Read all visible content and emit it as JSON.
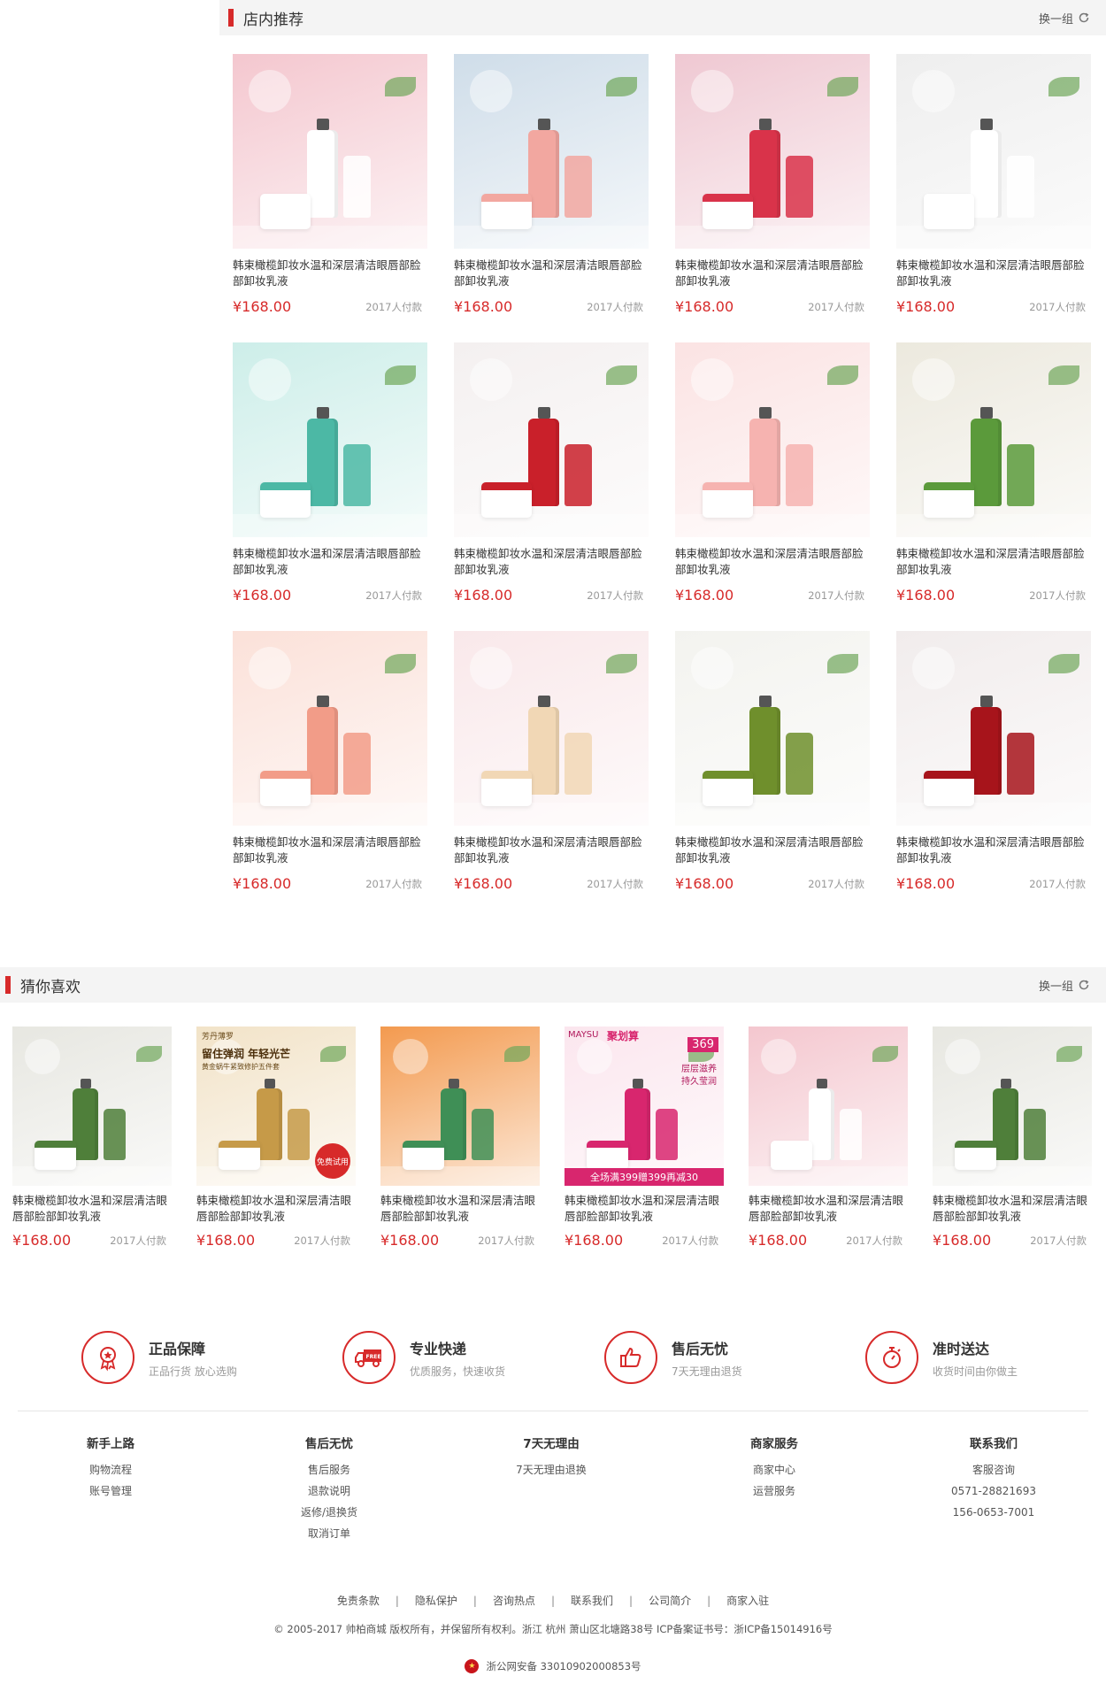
{
  "recommend": {
    "title": "店内推荐",
    "refresh_label": "换一组",
    "products": [
      {
        "name": "韩束橄榄卸妆水温和深层清洁眼唇部脸部卸妆乳液",
        "price": "¥168.00",
        "sold": "2017人付款",
        "bg": "#f4c7cf",
        "accent": "#ffffff"
      },
      {
        "name": "韩束橄榄卸妆水温和深层清洁眼唇部脸部卸妆乳液",
        "price": "¥168.00",
        "sold": "2017人付款",
        "bg": "#cfdde9",
        "accent": "#f2a7a0"
      },
      {
        "name": "韩束橄榄卸妆水温和深层清洁眼唇部脸部卸妆乳液",
        "price": "¥168.00",
        "sold": "2017人付款",
        "bg": "#efc8d2",
        "accent": "#d9334a"
      },
      {
        "name": "韩束橄榄卸妆水温和深层清洁眼唇部脸部卸妆乳液",
        "price": "¥168.00",
        "sold": "2017人付款",
        "bg": "#eeeeee",
        "accent": "#ffffff"
      },
      {
        "name": "韩束橄榄卸妆水温和深层清洁眼唇部脸部卸妆乳液",
        "price": "¥168.00",
        "sold": "2017人付款",
        "bg": "#cdeee9",
        "accent": "#4cb8a5"
      },
      {
        "name": "韩束橄榄卸妆水温和深层清洁眼唇部脸部卸妆乳液",
        "price": "¥168.00",
        "sold": "2017人付款",
        "bg": "#f4f0f0",
        "accent": "#c9202a"
      },
      {
        "name": "韩束橄榄卸妆水温和深层清洁眼唇部脸部卸妆乳液",
        "price": "¥168.00",
        "sold": "2017人付款",
        "bg": "#fbe3e3",
        "accent": "#f6b3b0"
      },
      {
        "name": "韩束橄榄卸妆水温和深层清洁眼唇部脸部卸妆乳液",
        "price": "¥168.00",
        "sold": "2017人付款",
        "bg": "#ece9de",
        "accent": "#5b9a3b"
      },
      {
        "name": "韩束橄榄卸妆水温和深层清洁眼唇部脸部卸妆乳液",
        "price": "¥168.00",
        "sold": "2017人付款",
        "bg": "#fbe1d9",
        "accent": "#f29c88"
      },
      {
        "name": "韩束橄榄卸妆水温和深层清洁眼唇部脸部卸妆乳液",
        "price": "¥168.00",
        "sold": "2017人付款",
        "bg": "#f9e8ea",
        "accent": "#f1d7b5"
      },
      {
        "name": "韩束橄榄卸妆水温和深层清洁眼唇部脸部卸妆乳液",
        "price": "¥168.00",
        "sold": "2017人付款",
        "bg": "#f3f3ef",
        "accent": "#6f8f2c"
      },
      {
        "name": "韩束橄榄卸妆水温和深层清洁眼唇部脸部卸妆乳液",
        "price": "¥168.00",
        "sold": "2017人付款",
        "bg": "#f1ecec",
        "accent": "#a7141b"
      }
    ]
  },
  "guess": {
    "title": "猜你喜欢",
    "refresh_label": "换一组",
    "products": [
      {
        "name": "韩束橄榄卸妆水温和深层清洁眼唇部脸部卸妆乳液",
        "price": "¥168.00",
        "sold": "2017人付款",
        "bg": "#e7e7e1",
        "accent": "#4f7f3a"
      },
      {
        "name": "韩束橄榄卸妆水温和深层清洁眼唇部脸部卸妆乳液",
        "price": "¥168.00",
        "sold": "2017人付款",
        "bg": "#f2e3c8",
        "accent": "#c69a48"
      },
      {
        "name": "韩束橄榄卸妆水温和深层清洁眼唇部脸部卸妆乳液",
        "price": "¥168.00",
        "sold": "2017人付款",
        "bg": "#f39a4f",
        "accent": "#3f8f56"
      },
      {
        "name": "韩束橄榄卸妆水温和深层清洁眼唇部脸部卸妆乳液",
        "price": "¥168.00",
        "sold": "2017人付款",
        "bg": "#fbe6ee",
        "accent": "#d8266e"
      },
      {
        "name": "韩束橄榄卸妆水温和深层清洁眼唇部脸部卸妆乳液",
        "price": "¥168.00",
        "sold": "2017人付款",
        "bg": "#f4c7cf",
        "accent": "#ffffff"
      },
      {
        "name": "韩束橄榄卸妆水温和深层清洁眼唇部脸部卸妆乳液",
        "price": "¥168.00",
        "sold": "2017人付款",
        "bg": "#e7e7e1",
        "accent": "#4f7f3a"
      }
    ],
    "image_texts": {
      "p1": "芳丹薄罗",
      "p1_slogan": "留住弹润 年轻光芒",
      "p1_sub": "黄金蜗牛紧致修护五件套",
      "p1_badge": "免费试用",
      "p3_brand": "MAYSU",
      "p3_tag": "聚划算",
      "p3_price": "369",
      "p3_slogan": "层层滋养\n持久莹润",
      "p3_banner": "全场满399赠399再减30"
    }
  },
  "services": [
    {
      "title": "正品保障",
      "sub": "正品行货  放心选购",
      "icon": "medal-icon"
    },
    {
      "title": "专业快递",
      "sub": "优质服务，快速收货",
      "icon": "truck-icon"
    },
    {
      "title": "售后无忧",
      "sub": "7天无理由退货",
      "icon": "thumbs-up-icon"
    },
    {
      "title": "准时送达",
      "sub": "收货时间由你做主",
      "icon": "stopwatch-icon"
    }
  ],
  "footer_columns": [
    {
      "title": "新手上路",
      "links": [
        "购物流程",
        "账号管理"
      ]
    },
    {
      "title": "售后无忧",
      "links": [
        "售后服务",
        "退款说明",
        "返修/退换货",
        "取消订单"
      ]
    },
    {
      "title": "7天无理由",
      "links": [
        "7天无理由退换"
      ]
    },
    {
      "title": "商家服务",
      "links": [
        "商家中心",
        "运营服务"
      ]
    },
    {
      "title": "联系我们",
      "links": [
        "客服咨询",
        "0571-28821693",
        "156-0653-7001"
      ]
    }
  ],
  "bottom_links": [
    "免责条款",
    "隐私保护",
    "咨询热点",
    "联系我们",
    "公司简介",
    "商家入驻"
  ],
  "copyright": "© 2005-2017 帅柏商城 版权所有，并保留所有权利。浙江 杭州 萧山区北塘路38号 ICP备案证书号：浙ICP备15014916号",
  "beian": "浙公网安备 33010902000853号",
  "colors": {
    "accent": "#d72a2a"
  }
}
